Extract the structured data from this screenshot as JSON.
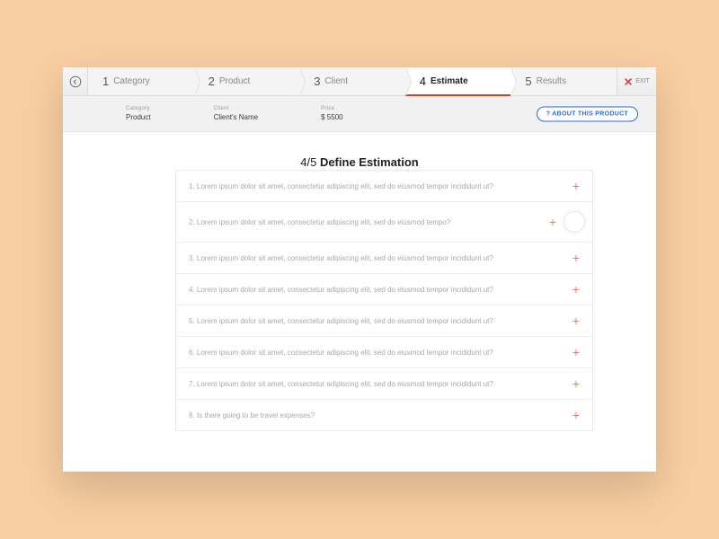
{
  "stepper": {
    "steps": [
      {
        "num": "1",
        "label": "Category"
      },
      {
        "num": "2",
        "label": "Product"
      },
      {
        "num": "3",
        "label": "Client"
      },
      {
        "num": "4",
        "label": "Estimate"
      },
      {
        "num": "5",
        "label": "Results"
      }
    ],
    "active_index": 3,
    "exit_label": "EXIT"
  },
  "summary": {
    "category": {
      "key": "Category",
      "value": "Product"
    },
    "client": {
      "key": "Client",
      "value": "Client's Name"
    },
    "price": {
      "key": "Price",
      "value": "$ 5500"
    },
    "about_button": "? ABOUT THIS PRODUCT"
  },
  "heading": {
    "prefix": "4/5 ",
    "title": "Define Estimation"
  },
  "questions": [
    "1. Lorem ipsum dolor sit amet, consectetur adipiscing elit, sed do eiusmod tempor incididunt ut?",
    "2. Lorem ipsum dolor sit amet, consectetur adipiscing elit, sed do eiusmod tempo?",
    "3. Lorem ipsum dolor sit amet, consectetur adipiscing elit, sed do eiusmod tempor incididunt ut?",
    "4. Lorem ipsum dolor sit amet, consectetur adipiscing elit, sed do eiusmod tempor incididunt ut?",
    "5. Lorem ipsum dolor sit amet, consectetur adipiscing elit, sed do eiusmod tempor incididunt ut?",
    "6. Lorem ipsum dolor sit amet, consectetur adipiscing elit, sed do eiusmod tempor incididunt ut?",
    "7. Lorem ipsum dolor sit amet, consectetur adipiscing elit, sed do eiusmod tempor incididunt ut?",
    "8. Is there going to be travel expenses?"
  ],
  "ripple_index": 1,
  "colors": {
    "accent": "#d64123",
    "link": "#2b6bd8",
    "plus": "#e38065"
  }
}
